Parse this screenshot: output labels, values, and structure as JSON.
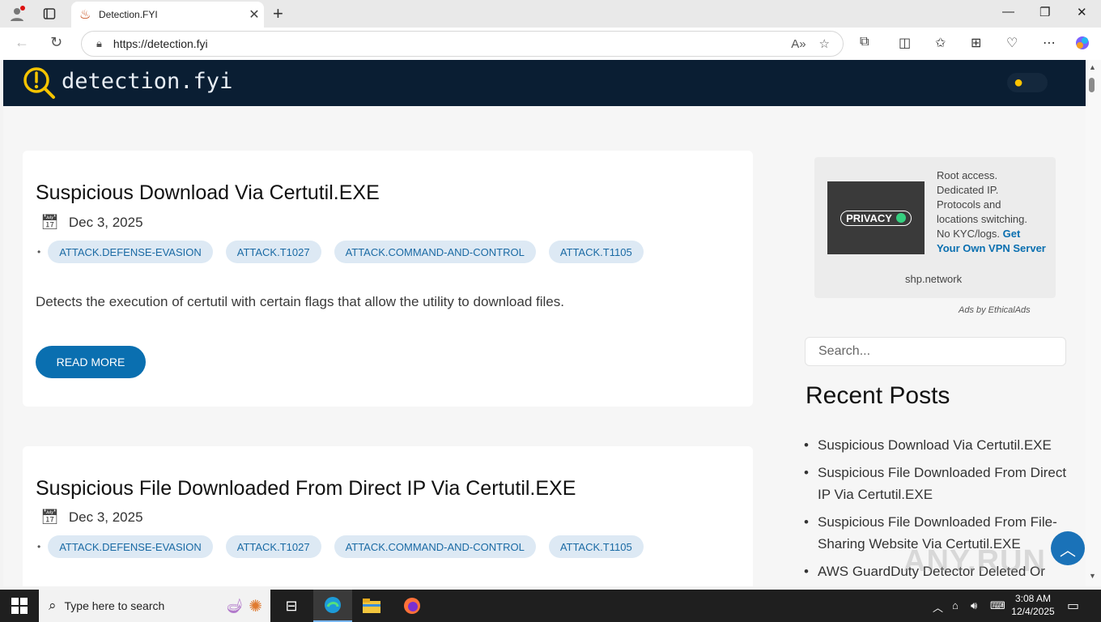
{
  "browser": {
    "tab_title": "Detection.FYI",
    "url": "https://detection.fyi",
    "new_tab_symbol": "+",
    "close_symbol": "✕"
  },
  "site": {
    "logo_text": "detection.fyi"
  },
  "posts": [
    {
      "title": "Suspicious Download Via Certutil.EXE",
      "date": "Dec 3, 2025",
      "tags": [
        "ATTACK.DEFENSE-EVASION",
        "ATTACK.T1027",
        "ATTACK.COMMAND-AND-CONTROL",
        "ATTACK.T1105"
      ],
      "excerpt": "Detects the execution of certutil with certain flags that allow the utility to download files.",
      "read_more": "READ MORE"
    },
    {
      "title": "Suspicious File Downloaded From Direct IP Via Certutil.EXE",
      "date": "Dec 3, 2025",
      "tags": [
        "ATTACK.DEFENSE-EVASION",
        "ATTACK.T1027",
        "ATTACK.COMMAND-AND-CONTROL",
        "ATTACK.T1105"
      ]
    }
  ],
  "ad": {
    "badge": "PRIVACY",
    "line1": "Root access.",
    "line2": "Dedicated IP.",
    "line3": "Protocols and",
    "line4": "locations switching.",
    "line5": "No KYC/logs.",
    "cta": "Get Your Own VPN Server",
    "domain": "shp.network",
    "by": "Ads by EthicalAds"
  },
  "sidebar": {
    "search_placeholder": "Search...",
    "recent_title": "Recent Posts",
    "recent": [
      "Suspicious Download Via Certutil.EXE",
      "Suspicious File Downloaded From Direct IP Via Certutil.EXE",
      "Suspicious File Downloaded From File-Sharing Website Via Certutil.EXE",
      "AWS GuardDuty Detector Deleted Or"
    ]
  },
  "watermark": "ANY.RUN",
  "taskbar": {
    "search_placeholder": "Type here to search",
    "time": "3:08 AM",
    "date": "12/4/2025"
  },
  "colors": {
    "header_bg": "#0a1e33",
    "accent": "#0a6fb0",
    "tag_bg": "#dde9f4"
  }
}
